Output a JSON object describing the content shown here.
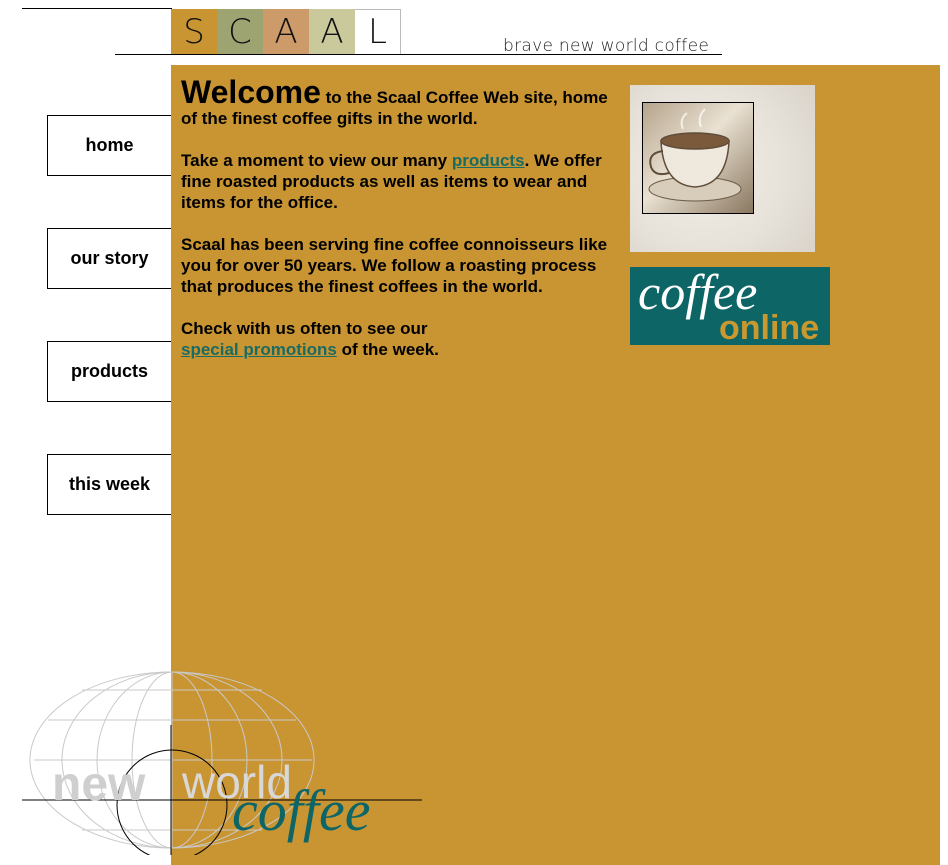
{
  "colors": {
    "panel": "#c99533",
    "teal": "#0e6566",
    "link": "#1a6b62"
  },
  "header": {
    "logo_letters": [
      {
        "letter": "S",
        "color": "#c99533"
      },
      {
        "letter": "C",
        "color": "#9da471"
      },
      {
        "letter": "A",
        "color": "#cd9a6a"
      },
      {
        "letter": "A",
        "color": "#c9c99c"
      },
      {
        "letter": "L",
        "color": "#ffffff"
      }
    ],
    "tagline": "brave new world coffee"
  },
  "nav": {
    "items": [
      {
        "label": "home"
      },
      {
        "label": "our story"
      },
      {
        "label": "products"
      },
      {
        "label": "this week"
      }
    ]
  },
  "content": {
    "welcome": "Welcome",
    "intro_rest": " to the Scaal Coffee Web site, home of the finest coffee gifts in the world.",
    "para2_before": "Take a moment to view our many ",
    "para2_link": "products",
    "para2_after": ". We offer fine roasted products as well as items to wear and items for the office.",
    "para3": "Scaal has been serving fine coffee connoisseurs like you for over 50 years. We follow a roasting process that produces the finest coffees in the world.",
    "para4_before": "Check with us often to see our ",
    "para4_link": "special promotions",
    "para4_after": " of the week."
  },
  "badge": {
    "line1": "coffee",
    "line2": "online"
  },
  "footer_logo": {
    "word1": "new",
    "word2": "world",
    "word3": "coffee"
  },
  "icons": {
    "photo": "coffee-cup-photo",
    "globe": "globe-icon"
  }
}
